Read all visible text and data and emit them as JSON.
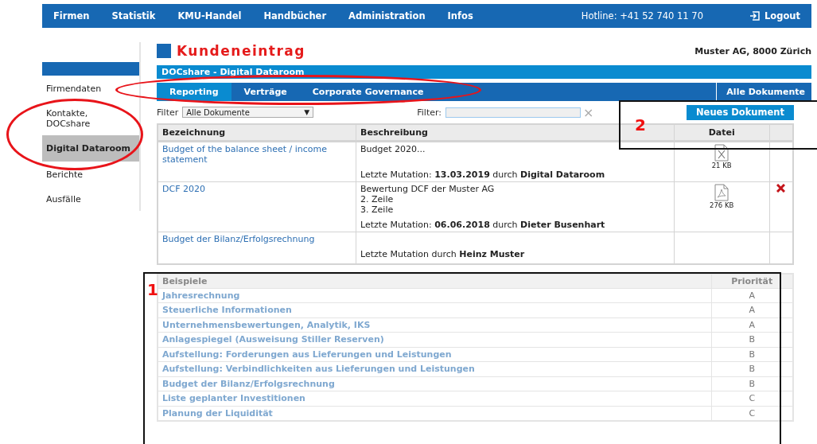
{
  "nav": {
    "items": [
      "Firmen",
      "Statistik",
      "KMU-Handel",
      "Handbücher",
      "Administration",
      "Infos"
    ],
    "hotline": "Hotline: +41 52 740 11 70",
    "logout": "Logout"
  },
  "sidebar": {
    "items": [
      {
        "label": "Firmendaten",
        "selected": false
      },
      {
        "label": "Kontakte, DOCshare",
        "selected": false
      },
      {
        "label": "Digital Dataroom",
        "selected": true
      },
      {
        "label": "Berichte",
        "selected": false
      },
      {
        "label": "Ausfälle",
        "selected": false
      }
    ]
  },
  "header": {
    "title": "Kundeneintrag",
    "company": "Muster AG, 8000 Zürich"
  },
  "section_title": "DOCshare - Digital Dataroom",
  "tabs": [
    {
      "label": "Reporting",
      "selected": true
    },
    {
      "label": "Verträge",
      "selected": false
    },
    {
      "label": "Corporate Governance",
      "selected": false
    }
  ],
  "all_documents": "Alle Dokumente",
  "filter": {
    "label": "Filter",
    "select_value": "Alle Dokumente",
    "caret": "▼",
    "search_label": "Filter:",
    "clear": "×"
  },
  "new_document": "Neues Dokument",
  "documents": {
    "columns": [
      "Bezeichnung",
      "Beschreibung",
      "Datei"
    ],
    "rows": [
      {
        "name": "Budget of the balance sheet / income statement",
        "description": [
          "Budget 2020..."
        ],
        "mutation": "Letzte Mutation: **13.03.2019** durch **Digital Dataroom**",
        "kind": "excel",
        "file_size": "21 KB",
        "deletable": false
      },
      {
        "name": "DCF 2020",
        "description": [
          "Bewertung DCF der Muster AG",
          "2. Zeile",
          "3. Zeile"
        ],
        "mutation": "Letzte Mutation: **06.06.2018** durch **Dieter Busenhart**",
        "kind": "pdf",
        "file_size": "276 KB",
        "deletable": true
      },
      {
        "name": "Budget der Bilanz/Erfolgsrechnung",
        "description": [],
        "mutation": "Letzte Mutation durch **Heinz Muster**",
        "kind": "none",
        "deletable": false
      }
    ]
  },
  "examples": {
    "columns": [
      "Beispiele",
      "Priorität"
    ],
    "rows": [
      {
        "name": "Jahresrechnung",
        "priority": "A"
      },
      {
        "name": "Steuerliche Informationen",
        "priority": "A"
      },
      {
        "name": "Unternehmensbewertungen, Analytik, IKS",
        "priority": "A"
      },
      {
        "name": "Anlagespiegel (Ausweisung Stiller Reserven)",
        "priority": "B"
      },
      {
        "name": "Aufstellung: Forderungen aus Lieferungen und Leistungen",
        "priority": "B"
      },
      {
        "name": "Aufstellung: Verbindlichkeiten aus Lieferungen und Leistungen",
        "priority": "B"
      },
      {
        "name": "Budget der Bilanz/Erfolgsrechnung",
        "priority": "B"
      },
      {
        "name": "Liste geplanter Investitionen",
        "priority": "C"
      },
      {
        "name": "Planung der Liquidität",
        "priority": "C"
      }
    ]
  },
  "annotations": [
    {
      "kind": "ellipse"
    },
    {
      "kind": "ellipse"
    },
    {
      "kind": "box",
      "number": "1"
    },
    {
      "kind": "box",
      "number": "2"
    }
  ]
}
